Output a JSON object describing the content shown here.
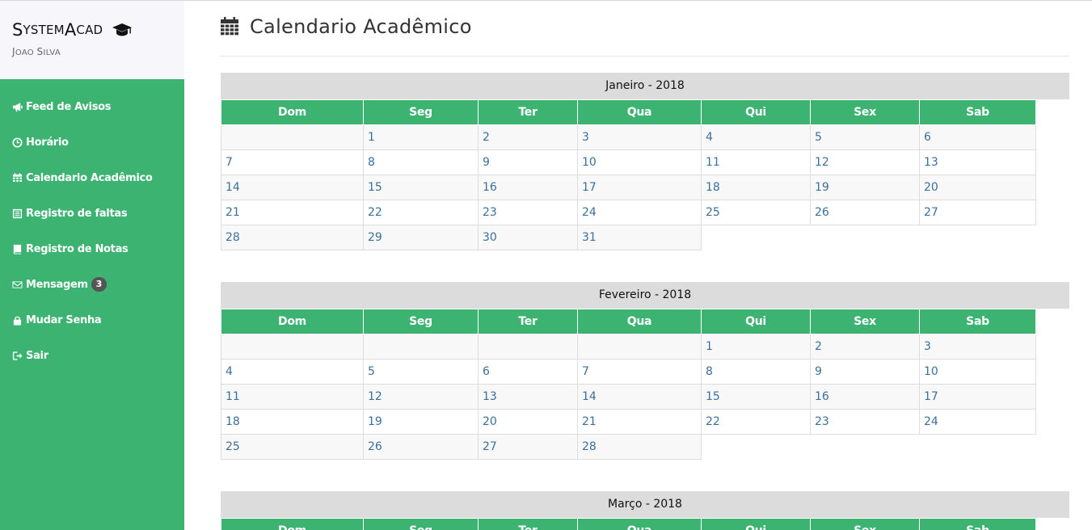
{
  "brand": {
    "title_first": "S",
    "title_mid": "ystem",
    "title_second": "A",
    "title_end": "cad",
    "user_first": "J",
    "user_mid": "oao ",
    "user_second": "S",
    "user_end": "ilva"
  },
  "nav": {
    "items": [
      {
        "label": "Feed de Avisos",
        "icon": "bullhorn-icon"
      },
      {
        "label": "Horário",
        "icon": "clock-icon"
      },
      {
        "label": "Calendario Acadêmico",
        "icon": "calendar-icon"
      },
      {
        "label": "Registro de faltas",
        "icon": "list-icon"
      },
      {
        "label": "Registro de Notas",
        "icon": "book-icon"
      },
      {
        "label": "Mensagem",
        "icon": "envelope-icon",
        "badge": "3"
      },
      {
        "label": "Mudar Senha",
        "icon": "lock-icon"
      },
      {
        "label": "Sair",
        "icon": "sign-out-icon"
      }
    ]
  },
  "page": {
    "title": "Calendario Acadêmico"
  },
  "weekdays": [
    "Dom",
    "Seg",
    "Ter",
    "Qua",
    "Qui",
    "Sex",
    "Sab"
  ],
  "months": [
    {
      "title": "Janeiro - 2018",
      "weeks": [
        [
          "",
          "1",
          "2",
          "3",
          "4",
          "5",
          "6"
        ],
        [
          "7",
          "8",
          "9",
          "10",
          "11",
          "12",
          "13"
        ],
        [
          "14",
          "15",
          "16",
          "17",
          "18",
          "19",
          "20"
        ],
        [
          "21",
          "22",
          "23",
          "24",
          "25",
          "26",
          "27"
        ],
        [
          "28",
          "29",
          "30",
          "31",
          null,
          null,
          null
        ]
      ]
    },
    {
      "title": "Fevereiro - 2018",
      "weeks": [
        [
          "",
          "",
          "",
          "",
          "1",
          "2",
          "3"
        ],
        [
          "4",
          "5",
          "6",
          "7",
          "8",
          "9",
          "10"
        ],
        [
          "11",
          "12",
          "13",
          "14",
          "15",
          "16",
          "17"
        ],
        [
          "18",
          "19",
          "20",
          "21",
          "22",
          "23",
          "24"
        ],
        [
          "25",
          "26",
          "27",
          "28",
          null,
          null,
          null
        ]
      ]
    },
    {
      "title": "Março - 2018",
      "weeks": []
    }
  ],
  "colors": {
    "accent": "#3cb371",
    "month_header": "#dcdcdc",
    "day_link": "#3a6f9c"
  }
}
